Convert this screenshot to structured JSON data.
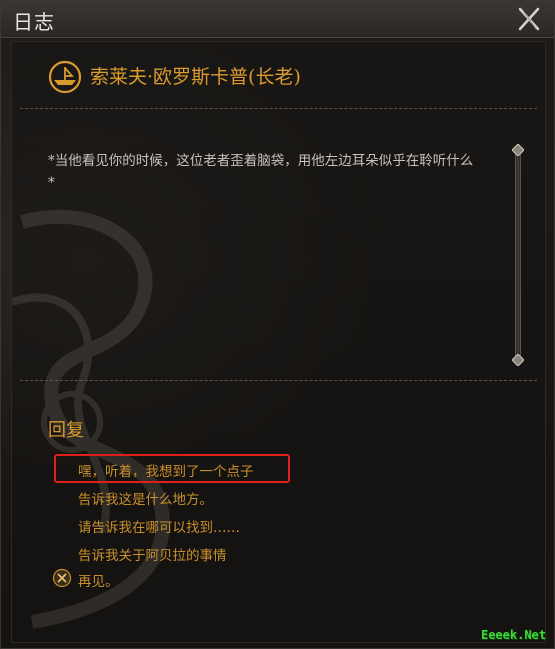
{
  "window": {
    "title": "日志",
    "close_icon": "close-icon"
  },
  "speaker": {
    "name": "索莱夫·欧罗斯卡普(长老)",
    "icon": "boat-emblem-icon"
  },
  "dialogue": {
    "text": "*当他看见你的时候，这位老者歪着脑袋，用他左边耳朵似乎在聆听什么*"
  },
  "replies": {
    "heading": "回复",
    "options": [
      "嘿，听着，我想到了一个点子",
      "告诉我这是什么地方。",
      "请告诉我在哪可以找到……",
      "告诉我关于阿贝拉的事情",
      "再见。"
    ],
    "highlighted_index": 0
  },
  "watermark": "Eeeek.Net",
  "colors": {
    "accent_gold": "#d99a2e",
    "reply_gold": "#c98f2c",
    "body_text": "#c9c3b8",
    "highlight_red": "#e0201a"
  }
}
